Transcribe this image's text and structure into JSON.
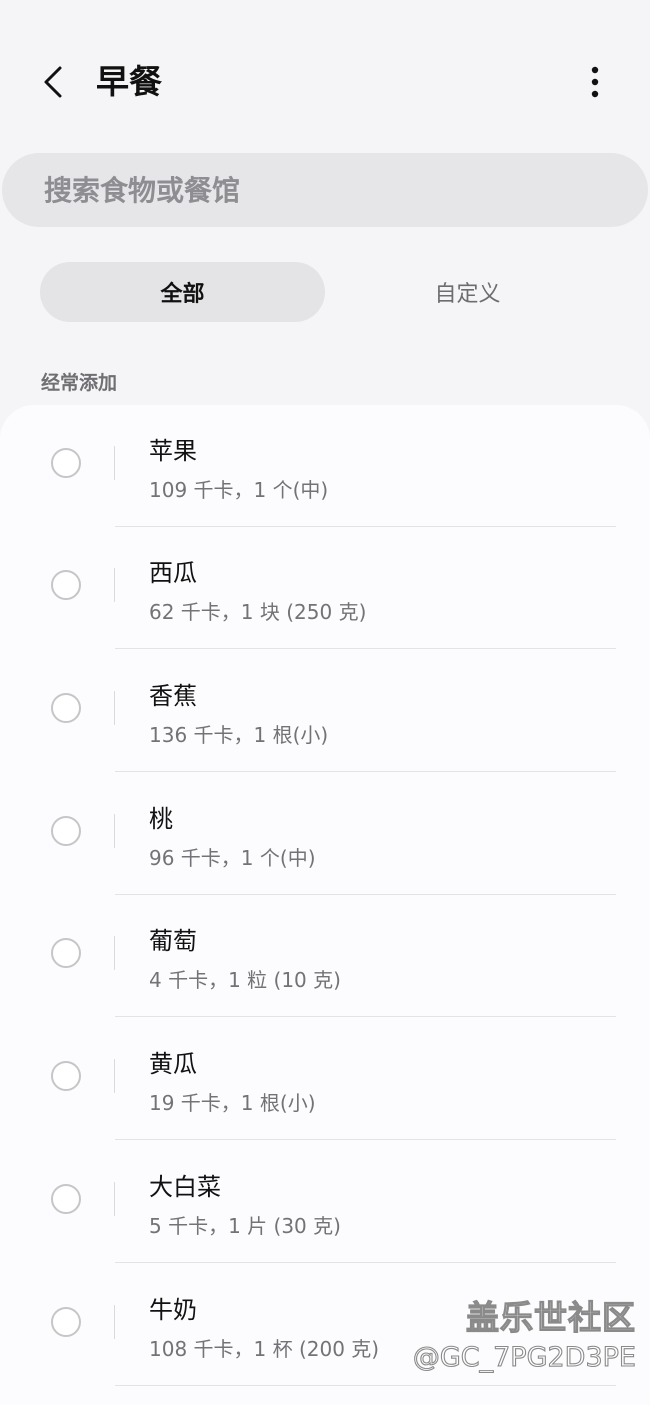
{
  "header": {
    "title": "早餐"
  },
  "search": {
    "placeholder": "搜索食物或餐馆"
  },
  "tabs": [
    {
      "label": "全部",
      "active": true
    },
    {
      "label": "自定义",
      "active": false
    }
  ],
  "section": {
    "label": "经常添加"
  },
  "items": [
    {
      "name": "苹果",
      "detail": "109 千卡，1 个(中)"
    },
    {
      "name": "西瓜",
      "detail": "62 千卡，1 块 (250 克)"
    },
    {
      "name": "香蕉",
      "detail": "136 千卡，1 根(小)"
    },
    {
      "name": "桃",
      "detail": "96 千卡，1 个(中)"
    },
    {
      "name": "葡萄",
      "detail": "4 千卡，1 粒 (10 克)"
    },
    {
      "name": "黄瓜",
      "detail": "19 千卡，1 根(小)"
    },
    {
      "name": "大白菜",
      "detail": "5 千卡，1 片 (30 克)"
    },
    {
      "name": "牛奶",
      "detail": "108 千卡，1 杯 (200 克)"
    }
  ],
  "watermark": {
    "line1": "盖乐世社区",
    "line2": "@GC_7PG2D3PE"
  },
  "icons": {
    "back": "chevron-left-icon",
    "more": "more-vertical-icon"
  }
}
